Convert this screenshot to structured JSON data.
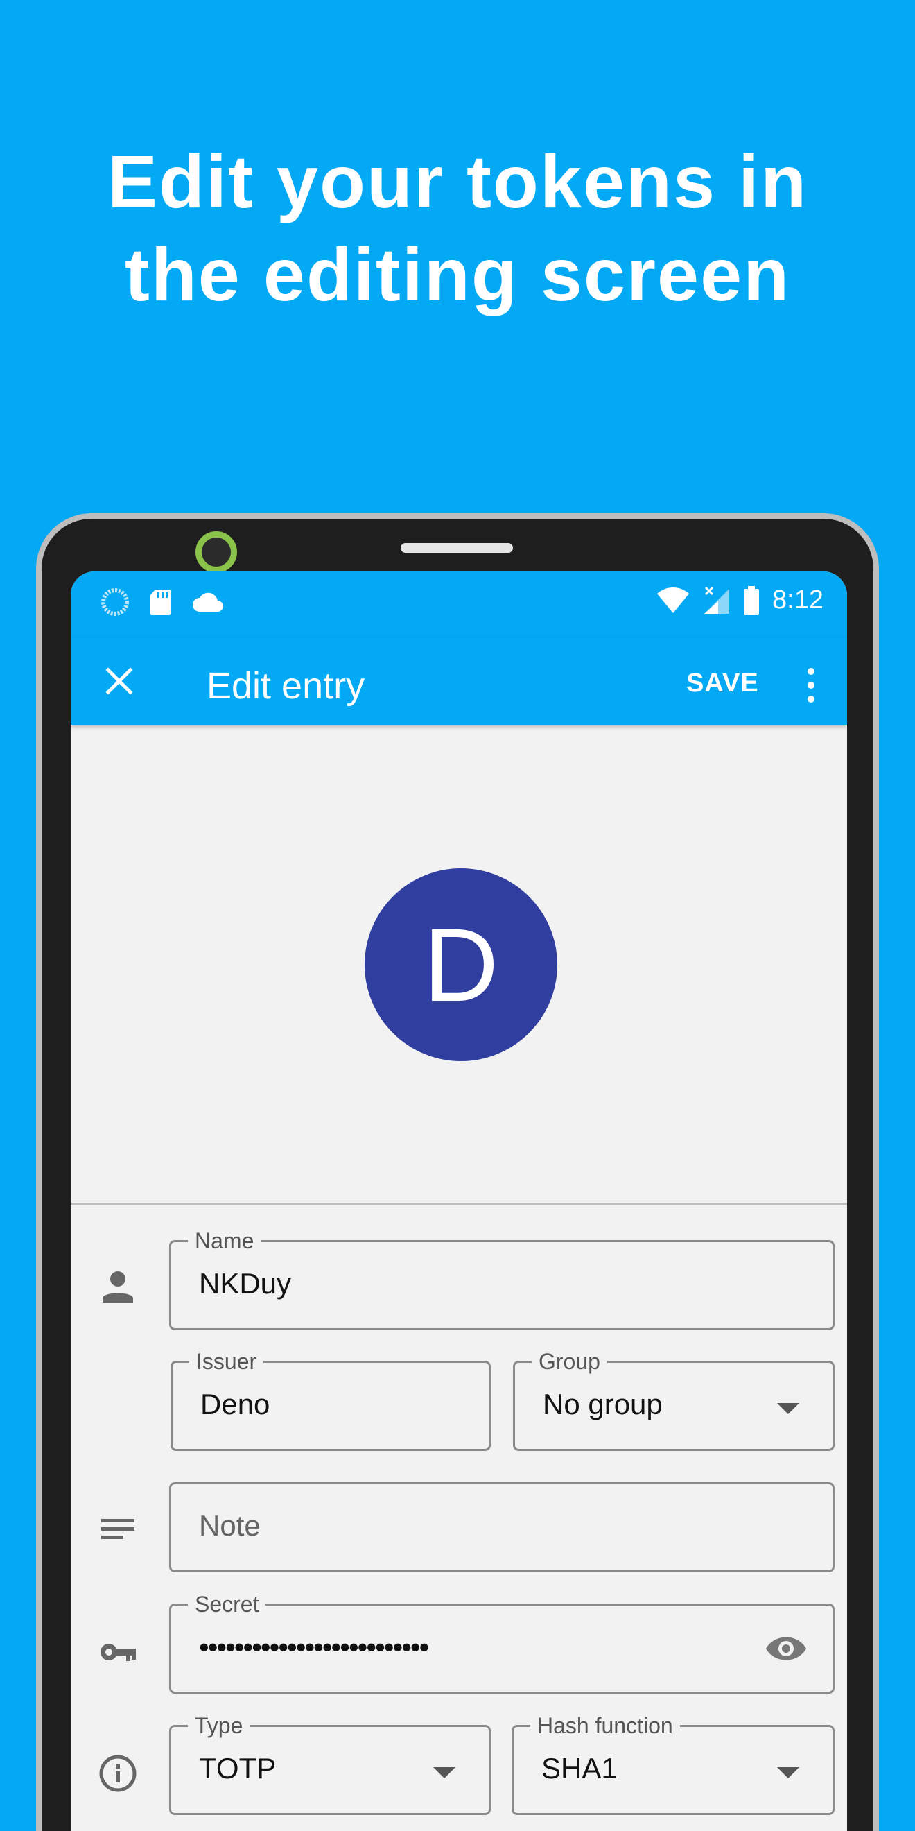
{
  "headline": {
    "line1": "Edit your tokens in",
    "line2": "the editing screen"
  },
  "status_bar": {
    "time": "8:12",
    "left_icons": [
      "loading-circle-icon",
      "sd-card-icon",
      "cloud-icon"
    ],
    "right_icons": [
      "wifi-icon",
      "signal-icon",
      "battery-icon"
    ]
  },
  "app_bar": {
    "title": "Edit entry",
    "save_label": "SAVE",
    "close_icon": "close-icon",
    "more_icon": "more-vert-icon"
  },
  "avatar": {
    "letter": "D",
    "color": "#303f9f"
  },
  "form": {
    "name": {
      "label": "Name",
      "value": "NKDuy"
    },
    "issuer": {
      "label": "Issuer",
      "value": "Deno"
    },
    "group": {
      "label": "Group",
      "value": "No group"
    },
    "note": {
      "placeholder": "Note"
    },
    "secret": {
      "label": "Secret",
      "value": "••••••••••••••••••••••••••"
    },
    "type": {
      "label": "Type",
      "value": "TOTP"
    },
    "hash": {
      "label": "Hash function",
      "value": "SHA1"
    }
  },
  "colors": {
    "accent": "#03a9f4",
    "surface": "#f2f2f2"
  }
}
